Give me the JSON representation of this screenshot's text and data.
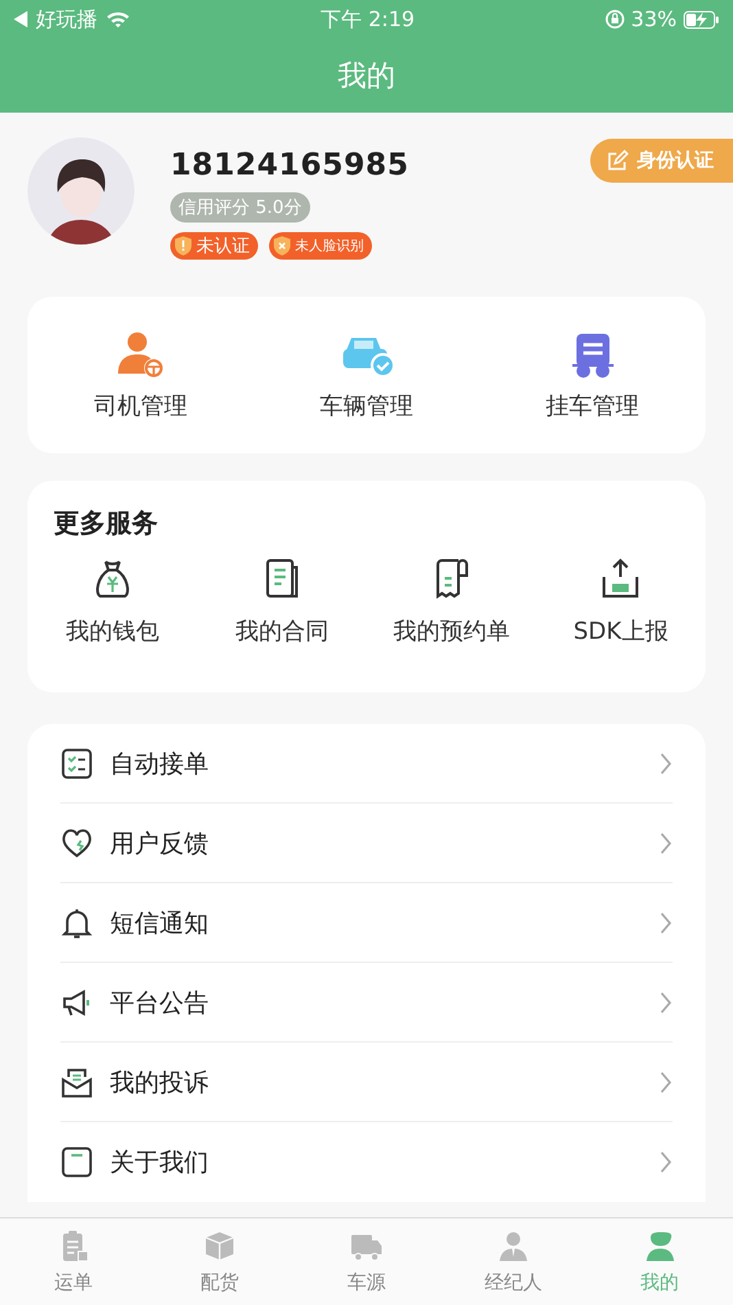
{
  "status_bar": {
    "back_label": "好玩播",
    "time": "下午 2:19",
    "battery": "33%"
  },
  "header": {
    "title": "我的"
  },
  "profile": {
    "phone": "18124165985",
    "credit": "信用评分 5.0分",
    "badges": [
      "未认证",
      "未人脸识别"
    ],
    "verify_button": "身份认证"
  },
  "management": [
    {
      "label": "司机管理"
    },
    {
      "label": "车辆管理"
    },
    {
      "label": "挂车管理"
    }
  ],
  "services": {
    "title": "更多服务",
    "items": [
      {
        "label": "我的钱包"
      },
      {
        "label": "我的合同"
      },
      {
        "label": "我的预约单"
      },
      {
        "label": "SDK上报"
      }
    ]
  },
  "menu": [
    {
      "label": "自动接单"
    },
    {
      "label": "用户反馈"
    },
    {
      "label": "短信通知"
    },
    {
      "label": "平台公告"
    },
    {
      "label": "我的投诉"
    },
    {
      "label": "关于我们"
    }
  ],
  "tabs": [
    {
      "label": "运单",
      "selected": false
    },
    {
      "label": "配货",
      "selected": false
    },
    {
      "label": "车源",
      "selected": false
    },
    {
      "label": "经纪人",
      "selected": false
    },
    {
      "label": "我的",
      "selected": true
    }
  ]
}
